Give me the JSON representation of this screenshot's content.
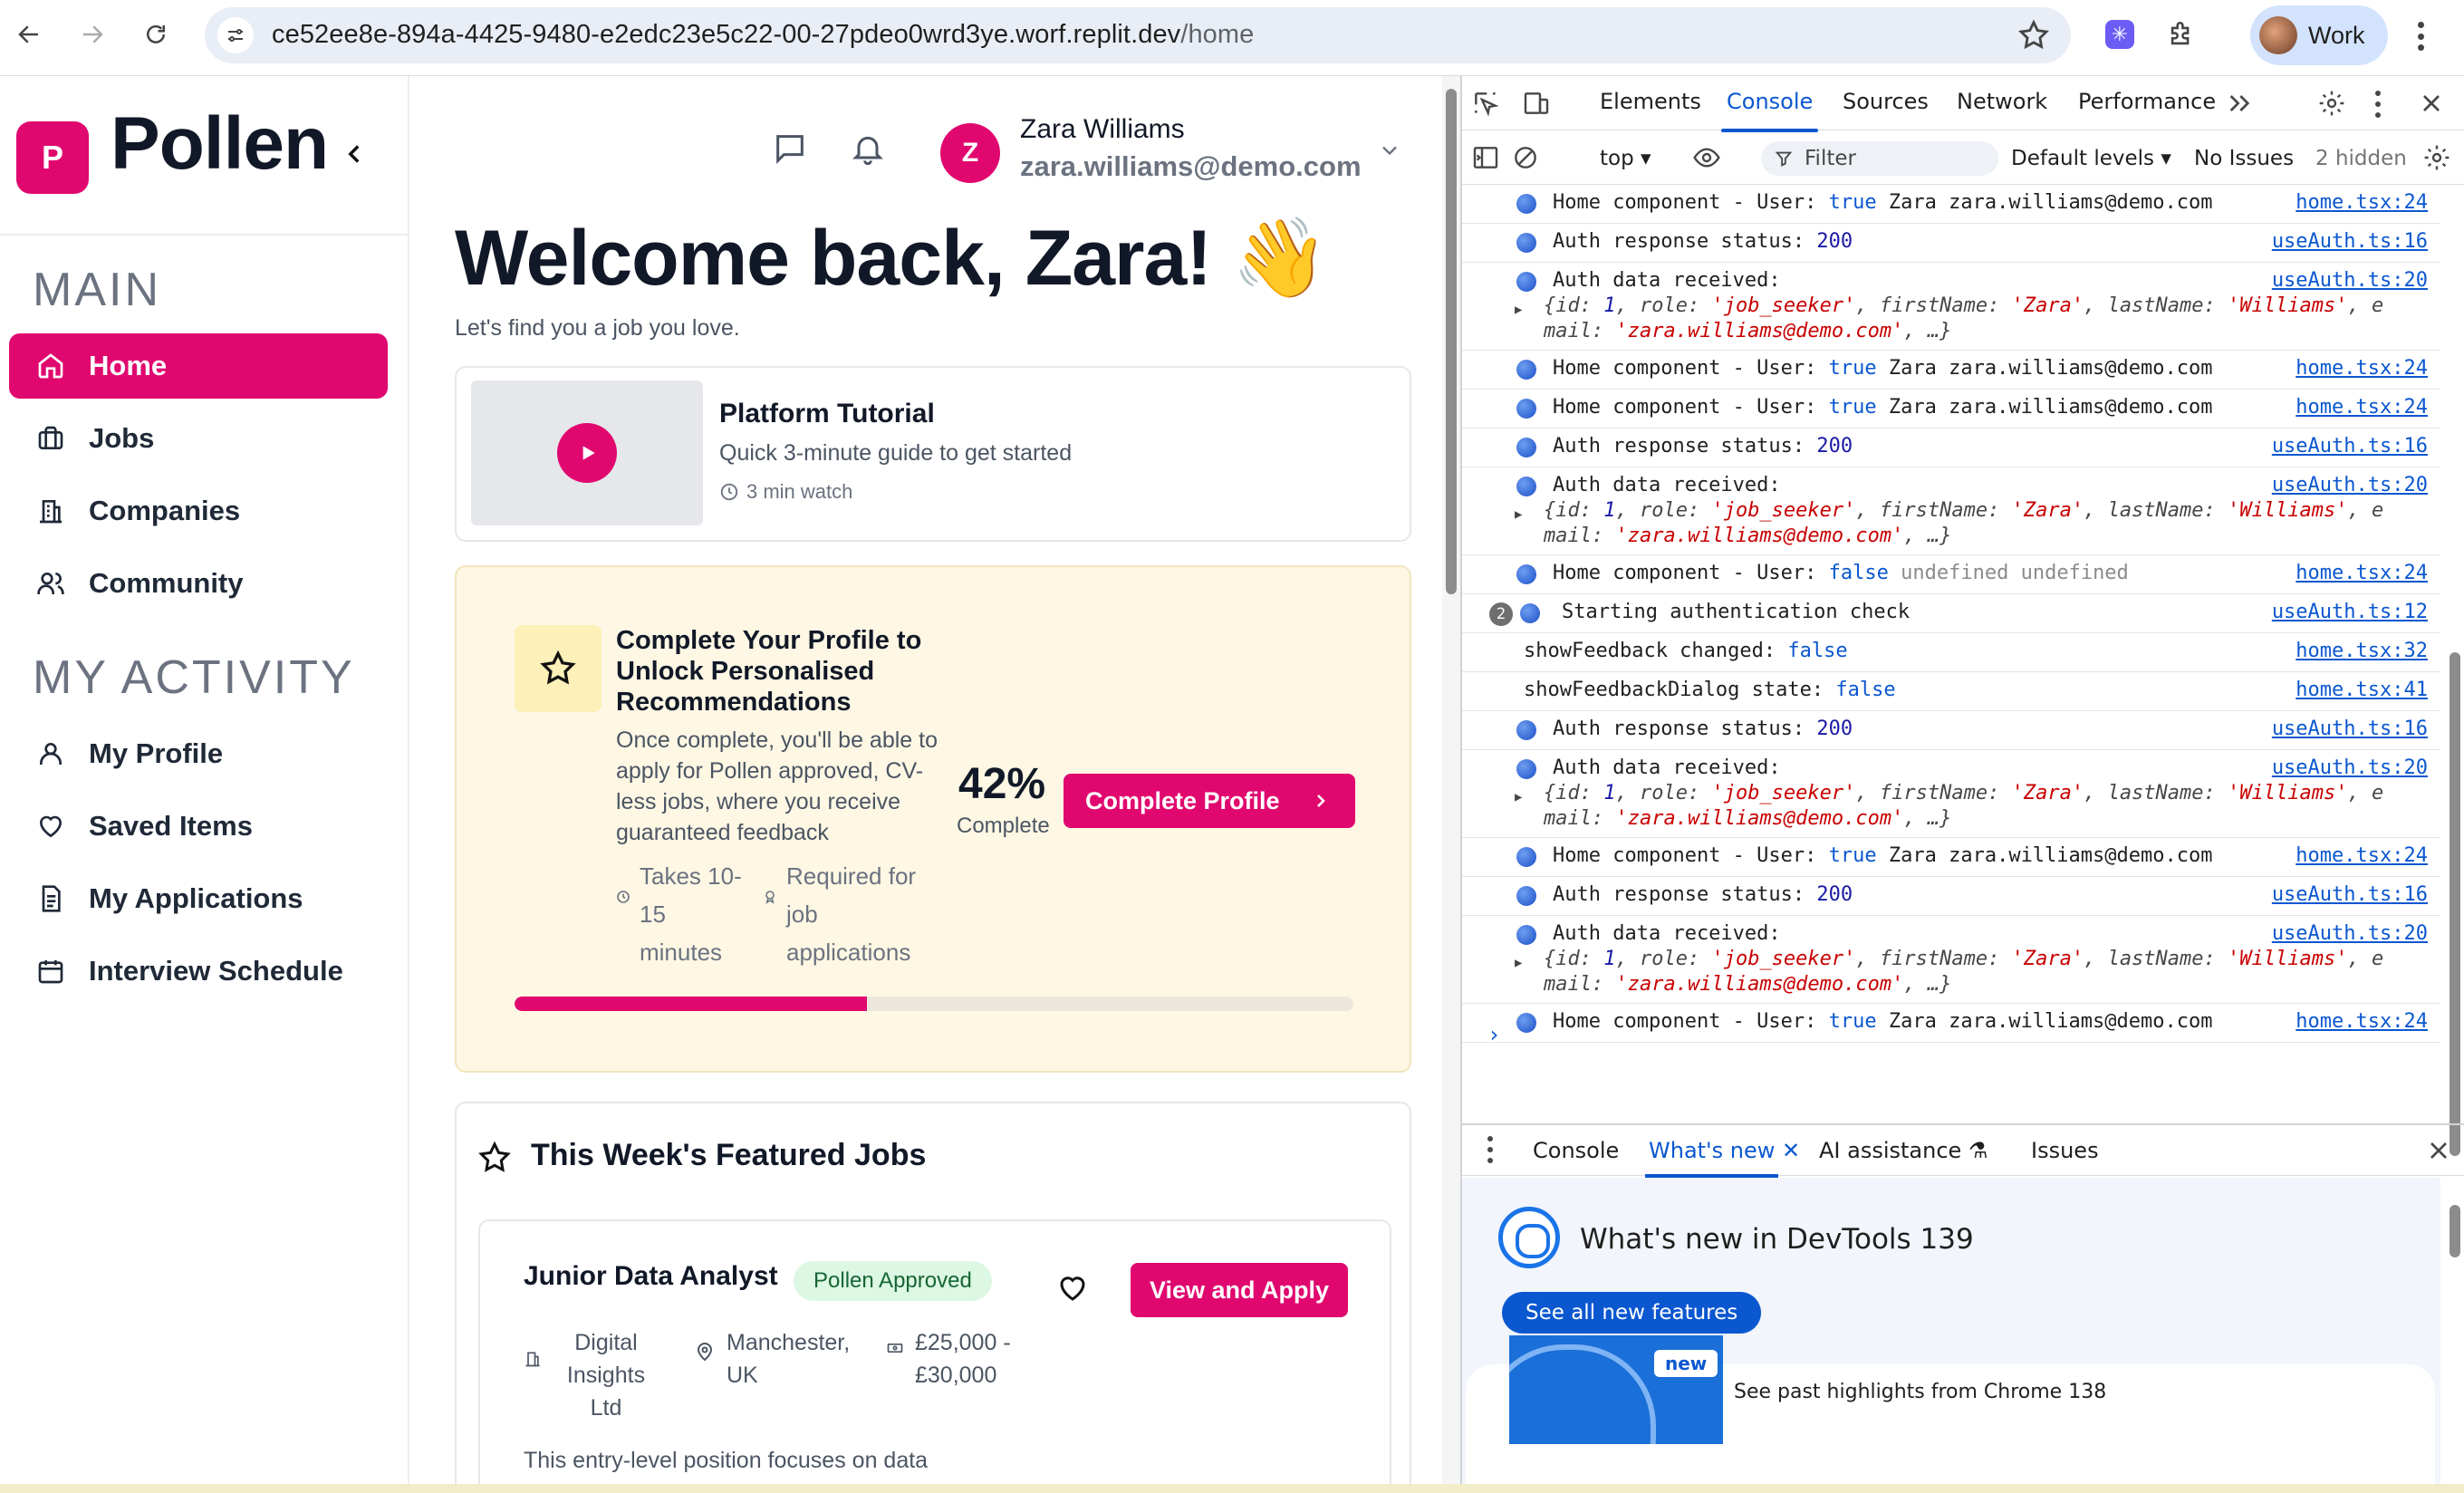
{
  "browser": {
    "url_host": "ce52ee8e-894a-4425-9480-e2edc23e5c22-00-27pdeo0wrd3ye.worf.replit.dev",
    "url_path": "/home",
    "profile_label": "Work"
  },
  "sidebar": {
    "logo_letter": "P",
    "brand": "Pollen",
    "main_title": "MAIN",
    "main_items": [
      {
        "label": "Home",
        "icon": "home-icon",
        "active": true
      },
      {
        "label": "Jobs",
        "icon": "briefcase-icon",
        "active": false
      },
      {
        "label": "Companies",
        "icon": "building-icon",
        "active": false
      },
      {
        "label": "Community",
        "icon": "users-icon",
        "active": false
      }
    ],
    "activity_title": "MY ACTIVITY",
    "activity_items": [
      {
        "label": "My Profile",
        "icon": "user-icon"
      },
      {
        "label": "Saved Items",
        "icon": "heart-icon"
      },
      {
        "label": "My Applications",
        "icon": "document-icon"
      },
      {
        "label": "Interview Schedule",
        "icon": "calendar-icon"
      }
    ]
  },
  "header": {
    "avatar_letter": "Z",
    "user_name": "Zara Williams",
    "user_email": "zara.williams@demo.com"
  },
  "main": {
    "welcome": "Welcome back, Zara! 👋",
    "subtitle": "Let's find you a job you love.",
    "tutorial": {
      "title": "Platform Tutorial",
      "description": "Quick 3-minute guide to get started",
      "duration": "3 min watch"
    },
    "profile_card": {
      "title": "Complete Your Profile to Unlock Personalised Recommendations",
      "description": "Once complete, you'll be able to apply for Pollen approved, CV-less jobs, where you receive guaranteed feedback",
      "time_note": "Takes 10-15 minutes",
      "required_note": "Required for job applications",
      "percent": "42%",
      "percent_label": "Complete",
      "progress_fraction": 0.42,
      "button": "Complete Profile"
    },
    "featured": {
      "title": "This Week's Featured Jobs",
      "job": {
        "title": "Junior Data Analyst",
        "badge": "Pollen Approved",
        "apply": "View and Apply",
        "company": "Digital Insights Ltd",
        "location": "Manchester, UK",
        "salary": "£25,000 - £30,000",
        "description": "This entry-level position focuses on data"
      }
    }
  },
  "devtools": {
    "tabs": [
      "Elements",
      "Console",
      "Sources",
      "Network",
      "Performance"
    ],
    "active_tab": "Console",
    "context": "top",
    "filter_placeholder": "Filter",
    "levels": "Default levels",
    "issues": "No Issues",
    "hidden": "2 hidden",
    "logs": [
      {
        "text": "Home component - User: true Zara zara.williams@demo.com",
        "src": "home.tsx:24"
      },
      {
        "text": "Auth response status: 200",
        "src": "useAuth.ts:16"
      },
      {
        "text": "Auth data received:",
        "src": "useAuth.ts:20",
        "obj1": "{id: 1, role: 'job_seeker', firstName: 'Zara', lastName: 'Williams', e",
        "obj2": "mail: 'zara.williams@demo.com', …}"
      },
      {
        "text": "Home component - User: true Zara zara.williams@demo.com",
        "src": "home.tsx:24"
      },
      {
        "text": "Home component - User: true Zara zara.williams@demo.com",
        "src": "home.tsx:24"
      },
      {
        "text": "Auth response status: 200",
        "src": "useAuth.ts:16"
      },
      {
        "text": "Auth data received:",
        "src": "useAuth.ts:20",
        "obj1": "{id: 1, role: 'job_seeker', firstName: 'Zara', lastName: 'Williams', e",
        "obj2": "mail: 'zara.williams@demo.com', …}"
      },
      {
        "text": "Home component - User: false undefined undefined",
        "src": "home.tsx:24"
      },
      {
        "text": "Starting authentication check",
        "src": "useAuth.ts:12",
        "count": "2"
      },
      {
        "text": "showFeedback changed: false",
        "src": "home.tsx:32",
        "plain": true
      },
      {
        "text": "showFeedbackDialog state: false",
        "src": "home.tsx:41",
        "plain": true
      },
      {
        "text": "Auth response status: 200",
        "src": "useAuth.ts:16"
      },
      {
        "text": "Auth data received:",
        "src": "useAuth.ts:20",
        "obj1": "{id: 1, role: 'job_seeker', firstName: 'Zara', lastName: 'Williams', e",
        "obj2": "mail: 'zara.williams@demo.com', …}"
      },
      {
        "text": "Home component - User: true Zara zara.williams@demo.com",
        "src": "home.tsx:24"
      },
      {
        "text": "Auth response status: 200",
        "src": "useAuth.ts:16"
      },
      {
        "text": "Auth data received:",
        "src": "useAuth.ts:20",
        "obj1": "{id: 1, role: 'job_seeker', firstName: 'Zara', lastName: 'Williams', e",
        "obj2": "mail: 'zara.williams@demo.com', …}"
      },
      {
        "text": "Home component - User: true Zara zara.williams@demo.com",
        "src": "home.tsx:24"
      }
    ],
    "drawer_tabs": [
      "Console",
      "What's new",
      "AI assistance",
      "Issues"
    ],
    "drawer_active": "What's new",
    "whats_new_title": "What's new in DevTools 139",
    "whats_new_button": "See all new features",
    "new_badge": "new",
    "highlight": "See past highlights from Chrome 138"
  },
  "colors": {
    "brand": "#e0086f",
    "devtools_accent": "#0b57d0",
    "profile_card_bg": "#fdf7e4"
  }
}
